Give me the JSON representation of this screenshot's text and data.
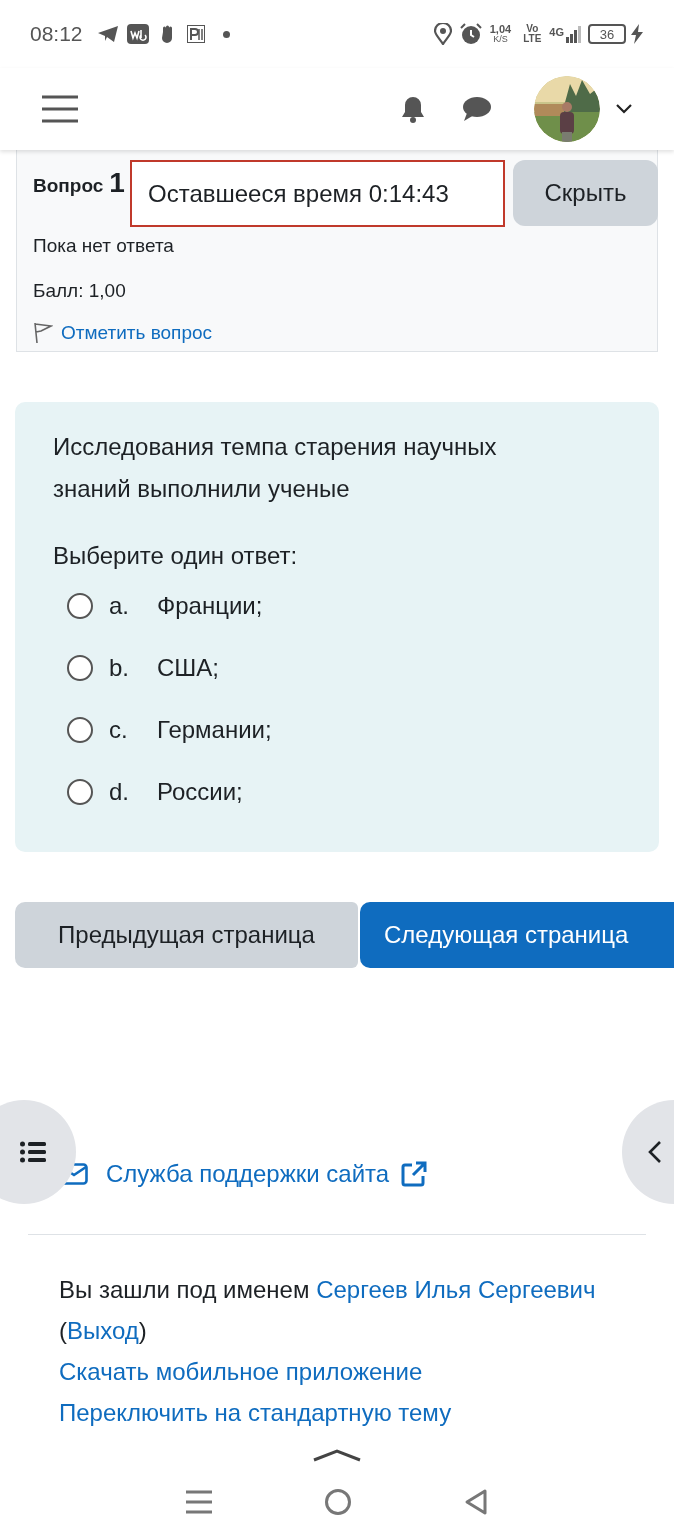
{
  "status_bar": {
    "time": "08:12",
    "speed": "1,04",
    "speed_unit": "K/S",
    "volte_top": "Vo",
    "volte_bottom": "LTE",
    "network": "4G",
    "battery": "36"
  },
  "question_info": {
    "label": "Вопрос",
    "number": "1",
    "status": "Пока нет ответа",
    "grade": "Балл: 1,00",
    "flag_link": "Отметить вопрос"
  },
  "timer": {
    "text": "Оставшееся время 0:14:43",
    "hide_button": "Скрыть"
  },
  "question": {
    "text": "Исследования темпа старения научных знаний выполнили ученые",
    "prompt": "Выберите один ответ:",
    "options": [
      {
        "letter": "a.",
        "text": "Франции;",
        "selected": false
      },
      {
        "letter": "b.",
        "text": "США;",
        "selected": false
      },
      {
        "letter": "c.",
        "text": "Германии;",
        "selected": false
      },
      {
        "letter": "d.",
        "text": "России;",
        "selected": false
      }
    ]
  },
  "navigation": {
    "previous": "Предыдущая страница",
    "next": "Следующая страница"
  },
  "footer": {
    "support_link": "Служба поддержки сайта",
    "login_prefix": "Вы зашли под именем",
    "user_name": "Сергеев Илья Сергеевич",
    "paren_open": "(",
    "logout": "Выход",
    "paren_close": ")",
    "app_link": "Скачать мобильное приложение",
    "theme_link": "Переключить на стандартную тему"
  }
}
